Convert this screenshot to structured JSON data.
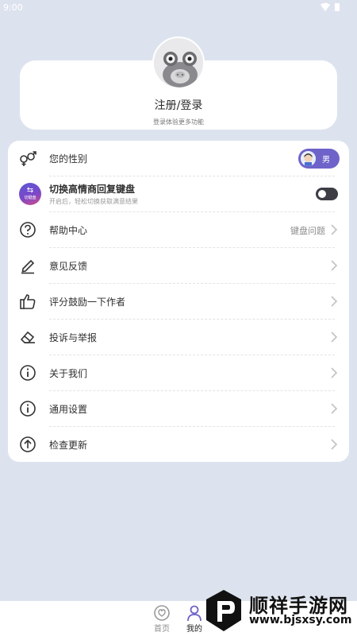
{
  "status_bar": {
    "time": "9:00"
  },
  "profile": {
    "title": "注册/登录",
    "subtitle": "登录体验更多功能"
  },
  "menu": {
    "gender": {
      "label": "您的性别",
      "value": "男"
    },
    "keyboard_switch": {
      "label": "切换高情商回复键盘",
      "sub": "开启后，轻松切换获取满意结果",
      "logo_text": "切键盘",
      "enabled": false
    },
    "help": {
      "label": "帮助中心",
      "value": "键盘问题"
    },
    "feedback": {
      "label": "意见反馈"
    },
    "rate": {
      "label": "评分鼓励一下作者"
    },
    "report": {
      "label": "投诉与举报"
    },
    "about": {
      "label": "关于我们"
    },
    "settings": {
      "label": "通用设置"
    },
    "update": {
      "label": "检查更新"
    }
  },
  "bottom_nav": {
    "home": "首页",
    "mine": "我的"
  },
  "watermark": {
    "brand": "顺祥手游网",
    "url": "www.bjsxsy.com"
  },
  "colors": {
    "background": "#dde3ee",
    "accent": "#6e63c9",
    "toggle_off": "#3d3d46"
  }
}
